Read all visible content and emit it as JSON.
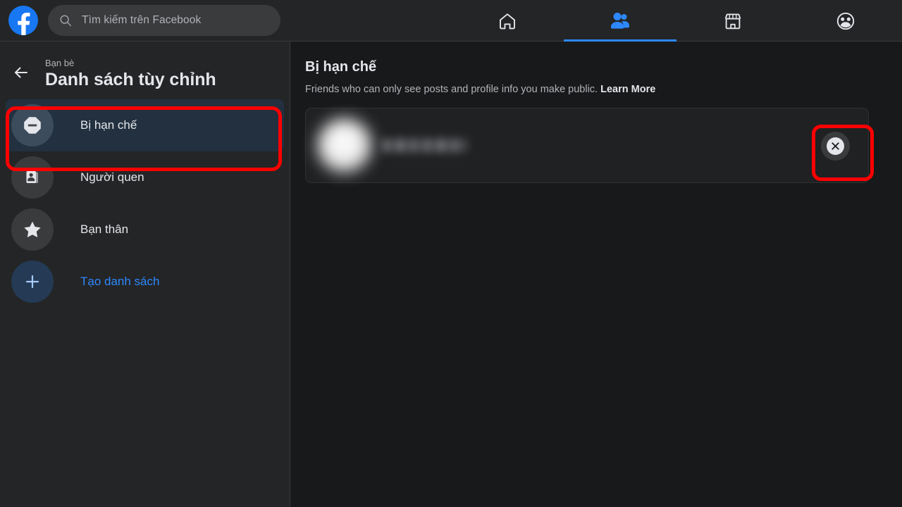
{
  "header": {
    "logo_icon": "facebook-logo-icon",
    "search": {
      "icon": "search-icon",
      "placeholder": "Tìm kiếm trên Facebook",
      "value": ""
    },
    "tabs": [
      {
        "icon": "home-icon",
        "name": "home",
        "active": false
      },
      {
        "icon": "friends-icon",
        "name": "friends",
        "active": true
      },
      {
        "icon": "marketplace-icon",
        "name": "marketplace",
        "active": false
      },
      {
        "icon": "groups-icon",
        "name": "groups",
        "active": false
      }
    ]
  },
  "sidebar": {
    "back_icon": "back-arrow-icon",
    "subtitle": "Bạn bè",
    "title": "Danh sách tùy chỉnh",
    "items": [
      {
        "label": "Bị hạn chế",
        "icon": "restricted-stop-icon",
        "selected": true
      },
      {
        "label": "Người quen",
        "icon": "contact-cards-icon",
        "selected": false
      },
      {
        "label": "Bạn thân",
        "icon": "star-icon",
        "selected": false
      },
      {
        "label": "Tạo danh sách",
        "icon": "plus-icon",
        "selected": false
      }
    ]
  },
  "main": {
    "title": "Bị hạn chế",
    "description": "Friends who can only see posts and profile info you make public.",
    "learn_more": "Learn More",
    "friends": [
      {
        "avatar": "blurred-avatar",
        "name": "",
        "remove_icon": "close-x-icon"
      }
    ]
  },
  "annotations": {
    "color": "#ff0000",
    "boxes": [
      {
        "target": "sidebar-item-restricted"
      },
      {
        "target": "remove-friend-button"
      }
    ]
  }
}
